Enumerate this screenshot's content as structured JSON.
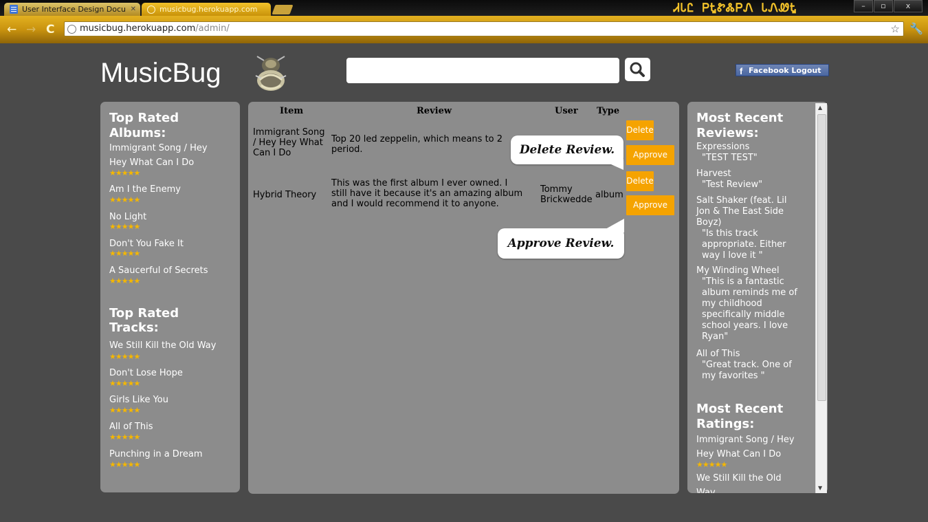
{
  "browser": {
    "tabs": [
      {
        "label": "User Interface Design Docu"
      },
      {
        "label": "musicbug.herokuapp.com"
      }
    ],
    "url_host": "musicbug.herokuapp.com",
    "url_path": "/admin/",
    "brand_glyphs": "ᏗᏓᏝ ᏢᎿᏑᏜᏢᏁ ᏓᏁᏪᎿ"
  },
  "header": {
    "logo": "MusicBug",
    "facebook_logout": "Facebook Logout"
  },
  "left": {
    "albums_title_1": "Top Rated",
    "albums_title_2": "Albums:",
    "albums": [
      "Immigrant Song / Hey",
      "Hey What Can I Do",
      "Am I the Enemy",
      "No Light",
      "Don't You Fake It",
      "A Saucerful of Secrets"
    ],
    "tracks_title_1": "Top Rated",
    "tracks_title_2": "Tracks:",
    "tracks": [
      "We Still Kill the Old Way",
      "Don't Lose Hope",
      "Girls Like You",
      "All of This",
      "Punching in a Dream"
    ],
    "stars": "★★★★★"
  },
  "table": {
    "headers": {
      "item": "Item",
      "review": "Review",
      "user": "User",
      "type": "Type"
    },
    "rows": [
      {
        "item_lines": [
          "Immigrant Song",
          "/ Hey Hey What",
          "Can I Do"
        ],
        "review_lines": [
          "Top 20 led zeppelin, which means to 2",
          "period."
        ],
        "user_lines": [],
        "type": ""
      },
      {
        "item_lines": [
          "Hybrid Theory"
        ],
        "review_lines": [
          "This was the first album I ever owned. I",
          "still have it because it's an amazing album",
          "and I would recommend it to anyone."
        ],
        "user_lines": [
          "Tommy",
          "Brickwedde"
        ],
        "type": "album"
      }
    ],
    "delete_label": "Delete",
    "approve_label": "Approve"
  },
  "callouts": {
    "delete": "Delete Review.",
    "approve": "Approve Review."
  },
  "right": {
    "reviews_title_1": "Most Recent",
    "reviews_title_2": "Reviews:",
    "reviews": [
      {
        "title": [
          "Expressions"
        ],
        "quote": [
          "\"TEST TEST\""
        ]
      },
      {
        "title": [
          "Harvest"
        ],
        "quote": [
          "\"Test Review\""
        ]
      },
      {
        "title": [
          "Salt Shaker (feat. Lil",
          "Jon & The East Side",
          "Boyz)"
        ],
        "quote": [
          "\"Is this track",
          "appropriate. Either",
          "way I love it \""
        ]
      },
      {
        "title": [
          "My Winding Wheel"
        ],
        "quote": [
          "\"This is a fantastic",
          "album reminds me of",
          "my childhood",
          "specifically middle",
          "school years. I love",
          "Ryan\""
        ]
      },
      {
        "title": [
          "All of This"
        ],
        "quote": [
          "\"Great track. One of",
          "my favorites \""
        ]
      }
    ],
    "ratings_title_1": "Most Recent",
    "ratings_title_2": "Ratings:",
    "ratings": [
      "Immigrant Song / Hey",
      "Hey What Can I Do",
      "We Still Kill the Old",
      "Way"
    ]
  },
  "colors": {
    "accent": "#f5a300",
    "star": "#f5b700",
    "panel": "#8c8c8c",
    "background": "#4a4a4a",
    "facebook": "#4b67a1"
  },
  "icons": [
    "doc-icon",
    "globe-icon",
    "back-icon",
    "forward-icon",
    "reload-icon",
    "bookmark-star-icon",
    "wrench-icon",
    "search-icon",
    "facebook-icon",
    "bug-logo-icon",
    "scroll-up-icon",
    "scroll-down-icon"
  ]
}
